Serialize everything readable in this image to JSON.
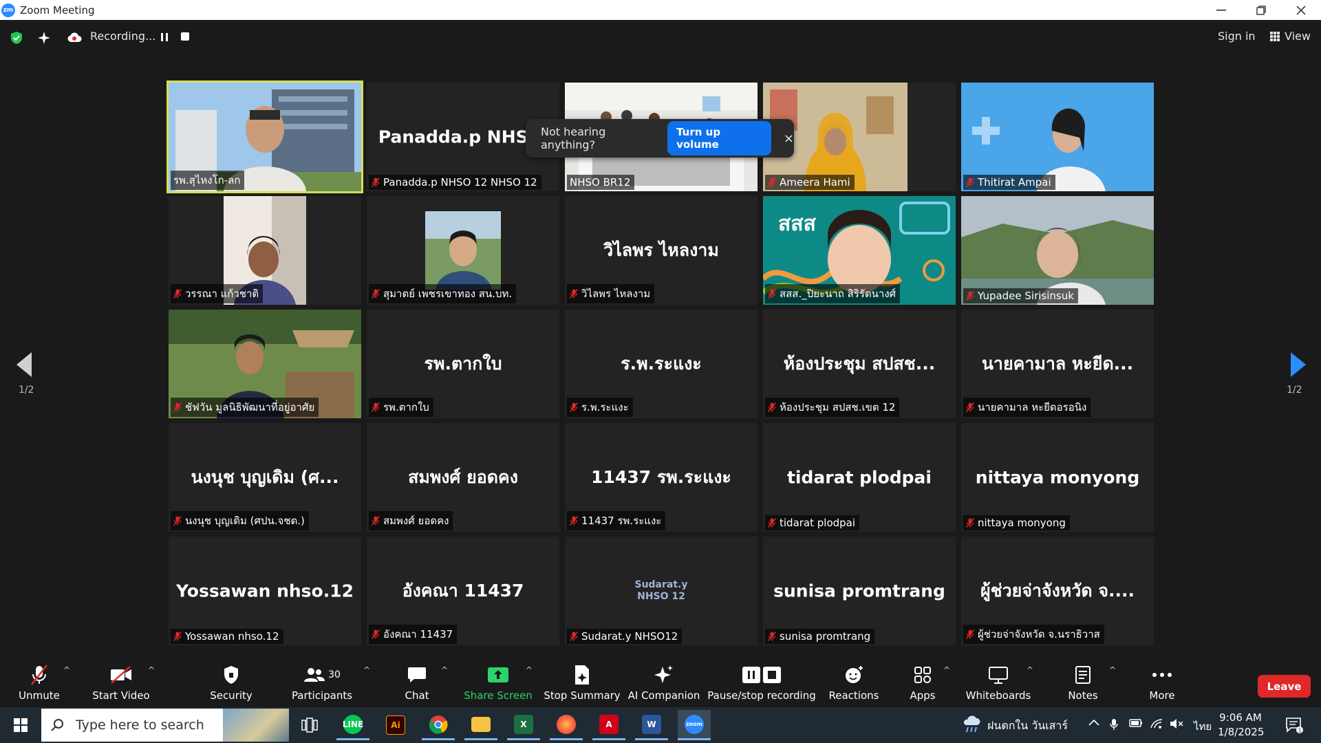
{
  "window": {
    "title": "Zoom Meeting",
    "logo": "zm"
  },
  "topbar": {
    "recording": "Recording...",
    "sign_in": "Sign in",
    "view": "View"
  },
  "toast": {
    "text": "Not hearing anything?",
    "button": "Turn up volume",
    "close": "×"
  },
  "pagination": {
    "left": "1/2",
    "right": "1/2"
  },
  "tiles": [
    {
      "label": "รพ.สุไหงโก-ลก",
      "video": true,
      "kind": "man-building",
      "active": true,
      "muted": false
    },
    {
      "name": "Panadda.p NHS...",
      "label": "Panadda.p NHSO 12 NHSO 12",
      "video": false,
      "muted": true
    },
    {
      "label": "NHSO BR12",
      "video": true,
      "kind": "conference-room",
      "muted": false
    },
    {
      "label": "Ameera Hami",
      "video": true,
      "kind": "woman-yellow",
      "muted": true
    },
    {
      "label": "Thitirat Ampai",
      "video": true,
      "kind": "woman-blue",
      "muted": true
    },
    {
      "label": "วรรณา แก้วชาติ",
      "video": true,
      "kind": "woman-window",
      "muted": true
    },
    {
      "label": "สุมาตย์ เพชรเขาทอง สน.บท.",
      "video": true,
      "kind": "man-outdoor",
      "muted": true
    },
    {
      "name": "วิไลพร ไหลงาม",
      "label": "วิไลพร ไหลงาม",
      "video": false,
      "muted": true
    },
    {
      "label": "สสส._ปิยะนาถ สิริรัตนางศ์",
      "video": true,
      "kind": "woman-green",
      "brand": "สสส",
      "muted": true
    },
    {
      "label": "Yupadee Sirisinsuk",
      "video": true,
      "kind": "woman-nature",
      "muted": true
    },
    {
      "label": "ชัฟวัน มูลนิธิพัฒนาที่อยู่อาศัย",
      "video": true,
      "kind": "man-garden",
      "muted": true
    },
    {
      "name": "รพ.ตากใบ",
      "label": "รพ.ตากใบ",
      "video": false,
      "muted": true
    },
    {
      "name": "ร.พ.ระแงะ",
      "label": "ร.พ.ระแงะ",
      "video": false,
      "muted": true
    },
    {
      "name": "ห้องประชุม สปสช...",
      "label": "ห้องประชุม สปสช.เขต 12",
      "video": false,
      "muted": true
    },
    {
      "name": "นายคามาล หะยีด...",
      "label": "นายคามาล หะยีดอรอนิง",
      "video": false,
      "muted": true
    },
    {
      "name": "นงนุช บุญเดิม (ศ...",
      "label": "นงนุช บุญเดิม (ศปน.จชต.)",
      "video": false,
      "muted": true
    },
    {
      "name": "สมพงศ์ ยอดคง",
      "label": "สมพงศ์ ยอดคง",
      "video": false,
      "muted": true
    },
    {
      "name": "11437 รพ.ระแงะ",
      "label": "11437 รพ.ระแงะ",
      "video": false,
      "muted": true
    },
    {
      "name": "tidarat plodpai",
      "label": "tidarat plodpai",
      "video": false,
      "muted": true
    },
    {
      "name": "nittaya monyong",
      "label": "nittaya monyong",
      "video": false,
      "muted": true
    },
    {
      "name": "Yossawan nhso.12",
      "label": "Yossawan nhso.12",
      "video": false,
      "muted": true
    },
    {
      "name": "อังคณา 11437",
      "label": "อังคณา 11437",
      "video": false,
      "muted": true
    },
    {
      "name": "Sudarat.y\nNHSO 12",
      "label": "Sudarat.y NHSO12",
      "video": false,
      "small": true,
      "muted": true
    },
    {
      "name": "sunisa promtrang",
      "label": "sunisa promtrang",
      "video": false,
      "muted": true
    },
    {
      "name": "ผู้ช่วยจ่าจังหวัด จ....",
      "label": "ผู้ช่วยจ่าจังหวัด จ.นราธิวาส",
      "video": false,
      "muted": true
    }
  ],
  "toolbar": {
    "unmute": "Unmute",
    "start_video": "Start Video",
    "security": "Security",
    "participants": "Participants",
    "participants_count": "30",
    "chat": "Chat",
    "share_screen": "Share Screen",
    "stop_summary": "Stop Summary",
    "ai_companion": "AI Companion",
    "pause_recording": "Pause/stop recording",
    "reactions": "Reactions",
    "apps": "Apps",
    "whiteboards": "Whiteboards",
    "notes": "Notes",
    "more": "More",
    "leave": "Leave",
    "share_color": "#2bd46b",
    "leave_color": "#e02828"
  },
  "taskbar": {
    "search_placeholder": "Type here to search",
    "weather": "ฝนตกใน วันเสาร์",
    "lang": "ไทย",
    "time": "9:06 AM",
    "date": "1/8/2025",
    "notif_count": "1",
    "apps": [
      "line",
      "illustrator",
      "chrome",
      "file-explorer",
      "excel",
      "firefox",
      "acrobat",
      "word",
      "zoom"
    ],
    "ai_label": "Ai",
    "zoom_label": "zoom"
  }
}
